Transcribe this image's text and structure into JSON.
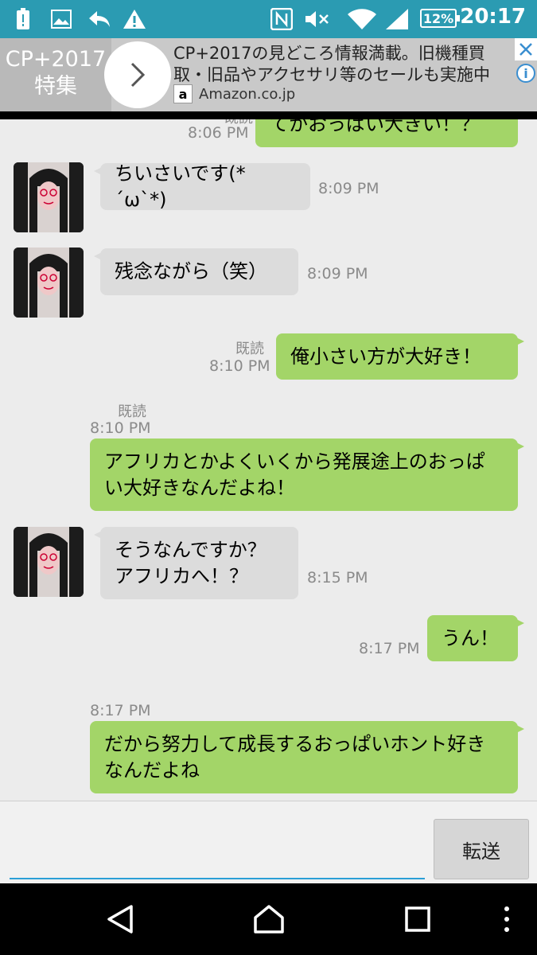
{
  "status_bar": {
    "time": "20:17",
    "battery": "12%",
    "icons": [
      "alert-battery-icon",
      "image-icon",
      "reply-icon",
      "warning-icon",
      "nfc-icon",
      "mute-icon",
      "wifi-icon",
      "signal-icon"
    ]
  },
  "ad": {
    "brand_line1": "CP+2017",
    "brand_line2": "特集",
    "text": "CP+2017の見どころ情報満載。旧機種買取・旧品やアクセサリ等のセールも実施中",
    "source_logo": "a",
    "source": "Amazon.co.jp",
    "close_label": "✕",
    "info_label": "i"
  },
  "messages": [
    {
      "side": "right",
      "text": "てかおっぱい大きい！？",
      "time": "8:06 PM",
      "read": "既読"
    },
    {
      "side": "left",
      "text": "ちいさいです(*´ω`*)",
      "time": "8:09 PM"
    },
    {
      "side": "left",
      "text": "残念ながら（笑）",
      "time": "8:09 PM"
    },
    {
      "side": "right",
      "text": "俺小さい方が大好き！",
      "time": "8:10 PM",
      "read": "既読"
    },
    {
      "side": "right",
      "text": "アフリカとかよくいくから発展途上のおっぱい大好きなんだよね！",
      "time": "8:10 PM",
      "read": "既読"
    },
    {
      "side": "left",
      "text": "そうなんですか？\nアフリカへ！？",
      "time": "8:15 PM"
    },
    {
      "side": "right",
      "text": "うん！",
      "time": "8:17 PM"
    },
    {
      "side": "right",
      "text": "だから努力して成長するおっぱいホント好きなんだよね",
      "time": "8:17 PM"
    }
  ],
  "input": {
    "value": "",
    "send_label": "転送"
  },
  "navbar": {
    "buttons": [
      "back-icon",
      "home-icon",
      "recents-icon",
      "more-icon"
    ]
  },
  "colors": {
    "status_bar": "#2b9bb2",
    "sent_bubble": "#a3d568",
    "received_bubble": "#dcdcdc",
    "chat_bg": "#ececec",
    "input_underline": "#2a9fd6"
  }
}
